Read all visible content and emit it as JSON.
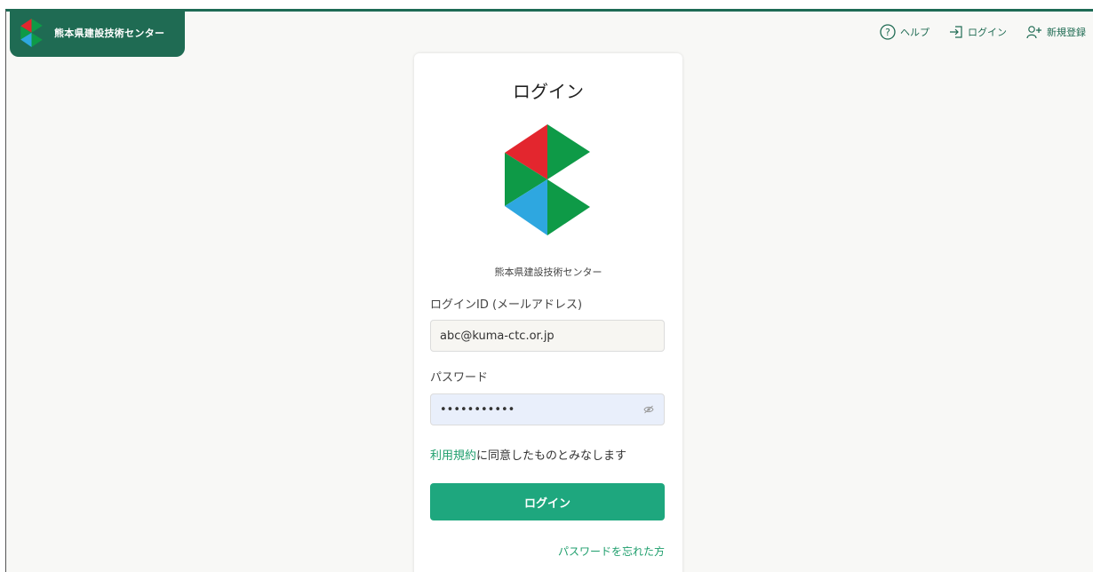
{
  "header": {
    "brand_name": "熊本県建設技術センター",
    "nav": [
      {
        "label": "ヘルプ",
        "icon": "help-circle-icon"
      },
      {
        "label": "ログイン",
        "icon": "login-icon"
      },
      {
        "label": "新規登録",
        "icon": "user-plus-icon"
      }
    ]
  },
  "login": {
    "title": "ログイン",
    "org_name": "熊本県建設技術センター",
    "id_label": "ログインID (メールアドレス)",
    "id_value": "abc@kuma-ctc.or.jp",
    "password_label": "パスワード",
    "password_value": "•••••••••••",
    "terms_link": "利用規約",
    "terms_text": "に同意したものとみなします",
    "submit_label": "ログイン",
    "forgot_label": "パスワードを忘れた方"
  },
  "colors": {
    "brand_green": "#1f6b53",
    "button_green": "#1ea77e",
    "link_green": "#1e9e6c",
    "logo_red": "#e3262e",
    "logo_green": "#0e9a47",
    "logo_blue": "#2ea7e0"
  }
}
